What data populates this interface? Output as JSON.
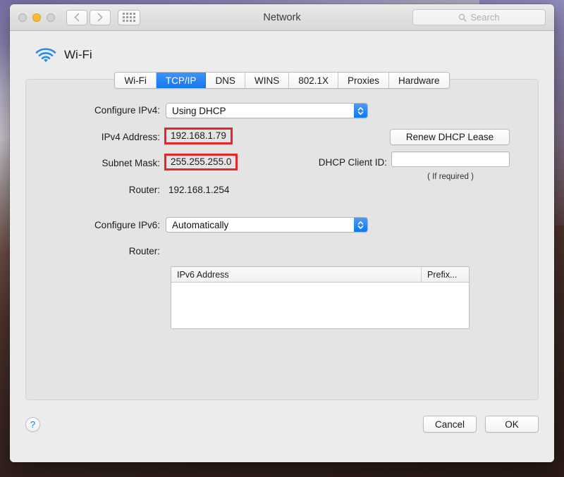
{
  "window": {
    "title": "Network",
    "traffic_lights": [
      {
        "name": "close",
        "state": "inactive"
      },
      {
        "name": "minimize",
        "state": "active",
        "color": "#fdbc2e"
      },
      {
        "name": "zoom",
        "state": "inactive"
      }
    ],
    "nav": {
      "back": "‹",
      "forward": "›"
    },
    "show_all_label": "show-all-grid"
  },
  "search": {
    "placeholder": "Search",
    "value": ""
  },
  "service": {
    "name": "Wi-Fi",
    "icon": "wifi-icon"
  },
  "tabs": [
    {
      "label": "Wi-Fi",
      "selected": false
    },
    {
      "label": "TCP/IP",
      "selected": true
    },
    {
      "label": "DNS",
      "selected": false
    },
    {
      "label": "WINS",
      "selected": false
    },
    {
      "label": "802.1X",
      "selected": false
    },
    {
      "label": "Proxies",
      "selected": false
    },
    {
      "label": "Hardware",
      "selected": false
    }
  ],
  "ipv4": {
    "configure_label": "Configure IPv4:",
    "configure_value": "Using DHCP",
    "address_label": "IPv4 Address:",
    "address_value": "192.168.1.79",
    "subnet_label": "Subnet Mask:",
    "subnet_value": "255.255.255.0",
    "router_label": "Router:",
    "router_value": "192.168.1.254"
  },
  "dhcp": {
    "renew_label": "Renew DHCP Lease",
    "client_id_label": "DHCP Client ID:",
    "client_id_value": "",
    "client_id_hint": "( If required )"
  },
  "ipv6": {
    "configure_label": "Configure IPv6:",
    "configure_value": "Automatically",
    "router_label": "Router:",
    "router_value": "",
    "table": {
      "columns": [
        "IPv6 Address",
        "Prefix..."
      ],
      "rows": []
    }
  },
  "footer": {
    "help_label": "?",
    "cancel_label": "Cancel",
    "ok_label": "OK"
  },
  "annotations": {
    "highlight_color": "#e8252a",
    "highlighted_fields": [
      "192.168.1.79",
      "255.255.255.0"
    ]
  }
}
